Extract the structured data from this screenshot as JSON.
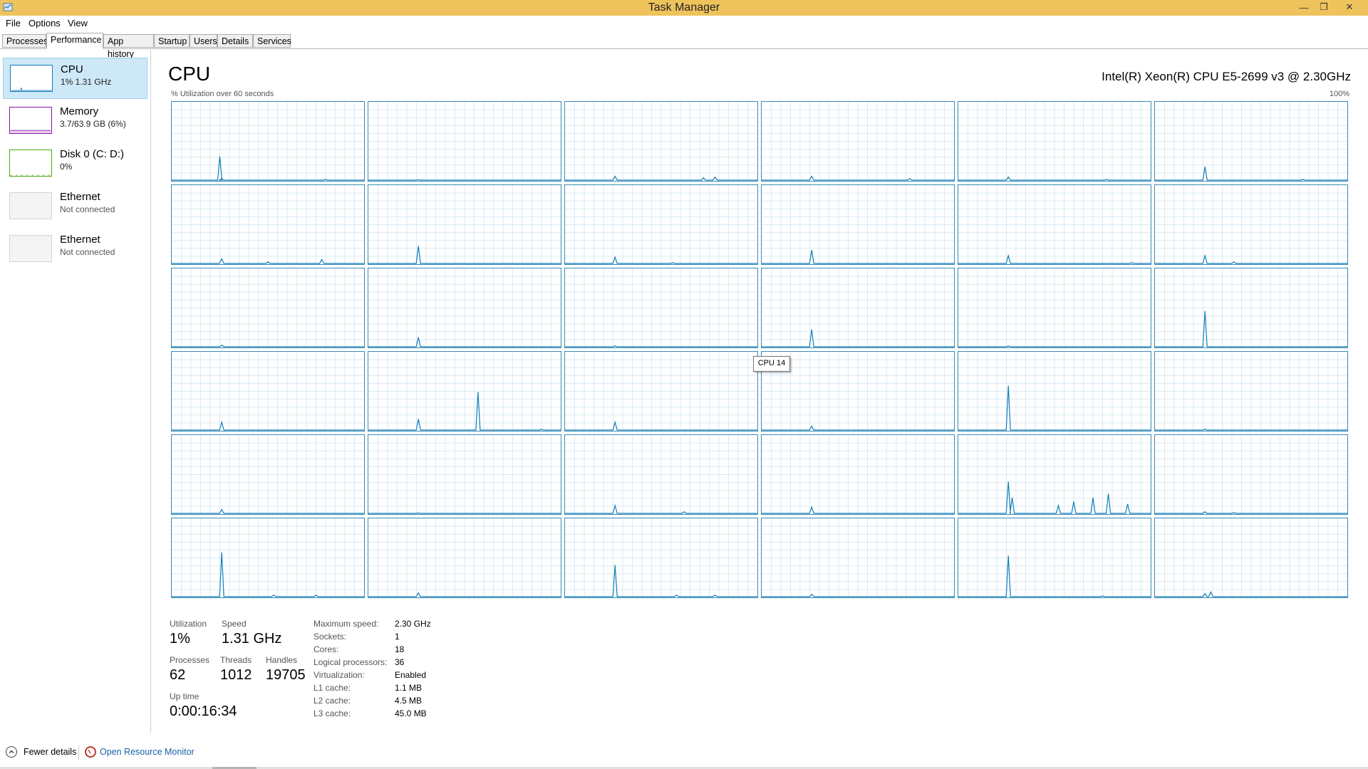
{
  "window": {
    "title": "Task Manager"
  },
  "menu": [
    "File",
    "Options",
    "View"
  ],
  "tabs": [
    "Processes",
    "Performance",
    "App history",
    "Startup",
    "Users",
    "Details",
    "Services"
  ],
  "sidebar": [
    {
      "name": "CPU",
      "sub": "1% 1.31 GHz",
      "color": "#117dbb"
    },
    {
      "name": "Memory",
      "sub": "3.7/63.9 GB (6%)",
      "color": "#8b12ae"
    },
    {
      "name": "Disk 0 (C: D:)",
      "sub": "0%",
      "color": "#4da60c"
    },
    {
      "name": "Ethernet",
      "sub": "Not connected",
      "color": "#a74f01"
    },
    {
      "name": "Ethernet",
      "sub": "Not connected",
      "color": "#a74f01"
    }
  ],
  "header": {
    "title": "CPU",
    "model": "Intel(R) Xeon(R) CPU E5-2699 v3 @ 2.30GHz",
    "util_label": "% Utilization over 60 seconds",
    "max_label": "100%"
  },
  "tooltip": "CPU 14",
  "stats": {
    "utilization_label": "Utilization",
    "utilization": "1%",
    "speed_label": "Speed",
    "speed": "1.31 GHz",
    "processes_label": "Processes",
    "processes": "62",
    "threads_label": "Threads",
    "threads": "1012",
    "handles_label": "Handles",
    "handles": "19705",
    "uptime_label": "Up time",
    "uptime": "0:00:16:34"
  },
  "specs": [
    {
      "label": "Maximum speed:",
      "value": "2.30 GHz"
    },
    {
      "label": "Sockets:",
      "value": "1"
    },
    {
      "label": "Cores:",
      "value": "18"
    },
    {
      "label": "Logical processors:",
      "value": "36"
    },
    {
      "label": "Virtualization:",
      "value": "Enabled"
    },
    {
      "label": "L1 cache:",
      "value": "1.1 MB"
    },
    {
      "label": "L2 cache:",
      "value": "4.5 MB"
    },
    {
      "label": "L3 cache:",
      "value": "45.0 MB"
    }
  ],
  "footer": {
    "fewer_details": "Fewer details",
    "resource_monitor": "Open Resource Monitor"
  },
  "colors": {
    "titlebar": "#efc35c",
    "graph_line": "#117dbb",
    "graph_border": "#3c8ab4",
    "grid": "#d9eaf4",
    "selected": "#cde8f7"
  },
  "cores": [
    [
      [
        25,
        30
      ],
      [
        26,
        2
      ],
      [
        80,
        1
      ]
    ],
    [
      [
        26,
        0.5
      ]
    ],
    [
      [
        26,
        5
      ],
      [
        72,
        3
      ],
      [
        78,
        4
      ]
    ],
    [
      [
        26,
        5
      ],
      [
        77,
        2
      ]
    ],
    [
      [
        26,
        4
      ],
      [
        77,
        1
      ]
    ],
    [
      [
        26,
        17
      ],
      [
        77,
        1
      ]
    ],
    [
      [
        26,
        6
      ],
      [
        50,
        2
      ],
      [
        78,
        5
      ]
    ],
    [
      [
        26,
        22
      ]
    ],
    [
      [
        26,
        8
      ],
      [
        56,
        1
      ]
    ],
    [
      [
        26,
        17
      ]
    ],
    [
      [
        26,
        10
      ],
      [
        90,
        1
      ]
    ],
    [
      [
        26,
        10
      ],
      [
        41,
        2
      ]
    ],
    [
      [
        26,
        2
      ]
    ],
    [
      [
        26,
        12
      ]
    ],
    [
      [
        26,
        1
      ]
    ],
    [
      [
        26,
        22
      ]
    ],
    [
      [
        26,
        1
      ]
    ],
    [
      [
        26,
        45
      ]
    ],
    [
      [
        26,
        10
      ]
    ],
    [
      [
        26,
        14
      ],
      [
        57,
        48
      ],
      [
        90,
        1
      ]
    ],
    [
      [
        26,
        10
      ]
    ],
    [
      [
        26,
        5
      ]
    ],
    [
      [
        26,
        56
      ]
    ],
    [
      [
        26,
        1
      ]
    ],
    [
      [
        26,
        5
      ]
    ],
    [
      [
        26,
        0.5
      ]
    ],
    [
      [
        26,
        10
      ],
      [
        62,
        2
      ]
    ],
    [
      [
        26,
        8
      ]
    ],
    [
      [
        26,
        40
      ],
      [
        28,
        20
      ],
      [
        52,
        10
      ],
      [
        60,
        15
      ],
      [
        70,
        20
      ],
      [
        78,
        25
      ],
      [
        88,
        12
      ]
    ],
    [
      [
        26,
        2
      ],
      [
        41,
        1
      ]
    ],
    [
      [
        26,
        56
      ],
      [
        53,
        2
      ],
      [
        75,
        2
      ]
    ],
    [
      [
        26,
        5
      ]
    ],
    [
      [
        26,
        40
      ],
      [
        58,
        2
      ],
      [
        78,
        2
      ]
    ],
    [
      [
        26,
        3
      ]
    ],
    [
      [
        26,
        52
      ],
      [
        75,
        1
      ]
    ],
    [
      [
        26,
        4
      ],
      [
        29,
        6
      ]
    ]
  ]
}
